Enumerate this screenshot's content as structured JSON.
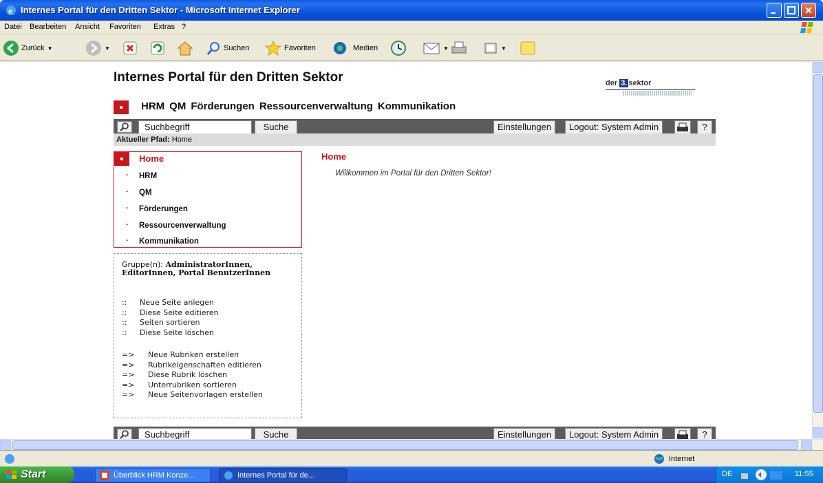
{
  "window": {
    "title": "Internes Portal für den Dritten Sektor - Microsoft Internet Explorer"
  },
  "menu": [
    "Datei",
    "Bearbeiten",
    "Ansicht",
    "Favoriten",
    "Extras",
    "?"
  ],
  "toolbar": {
    "back": "Zurück",
    "search": "Suchen",
    "favorites": "Favoriten",
    "media": "Medien"
  },
  "page": {
    "title": "Internes Portal für den Dritten Sektor",
    "logo": {
      "prefix": "der",
      "number": "3.",
      "suffix": "sektor"
    },
    "top_nav": [
      "HRM",
      "QM",
      "Förderungen",
      "Ressourcenverwaltung",
      "Kommunikation"
    ],
    "search": {
      "placeholder": "Suchbegriff",
      "button": "Suche",
      "settings": "Einstellungen",
      "logout": "Logout: System Admin",
      "help": "?"
    },
    "path": {
      "label": "Aktueller Pfad:",
      "value": "Home"
    },
    "nav": {
      "head": "Home",
      "items": [
        "HRM",
        "QM",
        "Förderungen",
        "Ressourcenverwaltung",
        "Kommunikation"
      ]
    },
    "admin": {
      "groups_label": "Gruppe(n):",
      "groups_value": "AdministratorInnen, EditorInnen, Portal BenutzerInnen",
      "page_actions_marker": "::",
      "page_actions": [
        "Neue Seite anlegen",
        "Diese Seite editieren",
        "Seiten sortieren",
        "Diese Seite löschen"
      ],
      "rubric_actions_marker": "=>",
      "rubric_actions": [
        "Neue Rubriken erstellen",
        "Rubrikeigenschaften editieren",
        "Diese Rubrik löschen",
        "Unterrubriken sortieren",
        "Neue Seitenvorlagen erstellen"
      ]
    },
    "content": {
      "heading": "Home",
      "welcome": "Willkommen im Portal für den Dritten Sektor!"
    }
  },
  "statusbar": {
    "zone": "Internet"
  },
  "taskbar": {
    "start": "Start",
    "tasks": [
      "Überblick HRM Konze...",
      "Internes Portal für de..."
    ],
    "lang": "DE",
    "clock": "11:55"
  },
  "colors": {
    "accent": "#c8161d",
    "bar": "#5c5c5c",
    "titlebar": "#0855dc"
  }
}
